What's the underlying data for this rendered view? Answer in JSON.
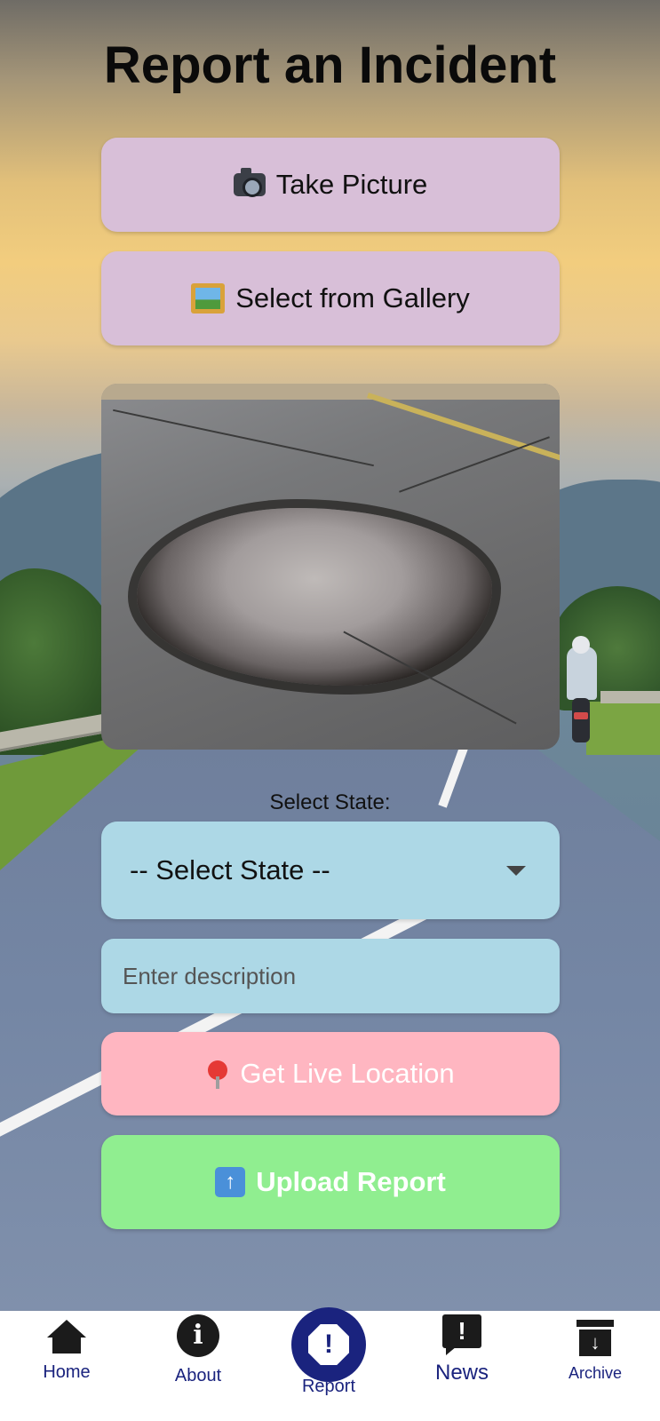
{
  "page": {
    "title": "Report an Incident"
  },
  "actions": {
    "take_picture_label": "Take Picture",
    "gallery_label": "Select from Gallery",
    "location_label": "Get Live Location",
    "upload_label": "Upload Report"
  },
  "form": {
    "state_label": "Select State:",
    "state_selected": "-- Select State --",
    "description_placeholder": "Enter description",
    "description_value": ""
  },
  "preview": {
    "image_subject": "pothole-photo"
  },
  "nav": {
    "items": [
      {
        "label": "Home",
        "icon": "home-icon"
      },
      {
        "label": "About",
        "icon": "info-icon"
      },
      {
        "label": "Report",
        "icon": "report-icon",
        "active": true
      },
      {
        "label": "News",
        "icon": "news-icon"
      },
      {
        "label": "Archive",
        "icon": "archive-icon"
      }
    ]
  },
  "colors": {
    "purple_button": "#d8bfd8",
    "blue_field": "#add8e6",
    "pink_button": "#ffb6c1",
    "green_button": "#90ee90",
    "nav_accent": "#1a237e"
  }
}
